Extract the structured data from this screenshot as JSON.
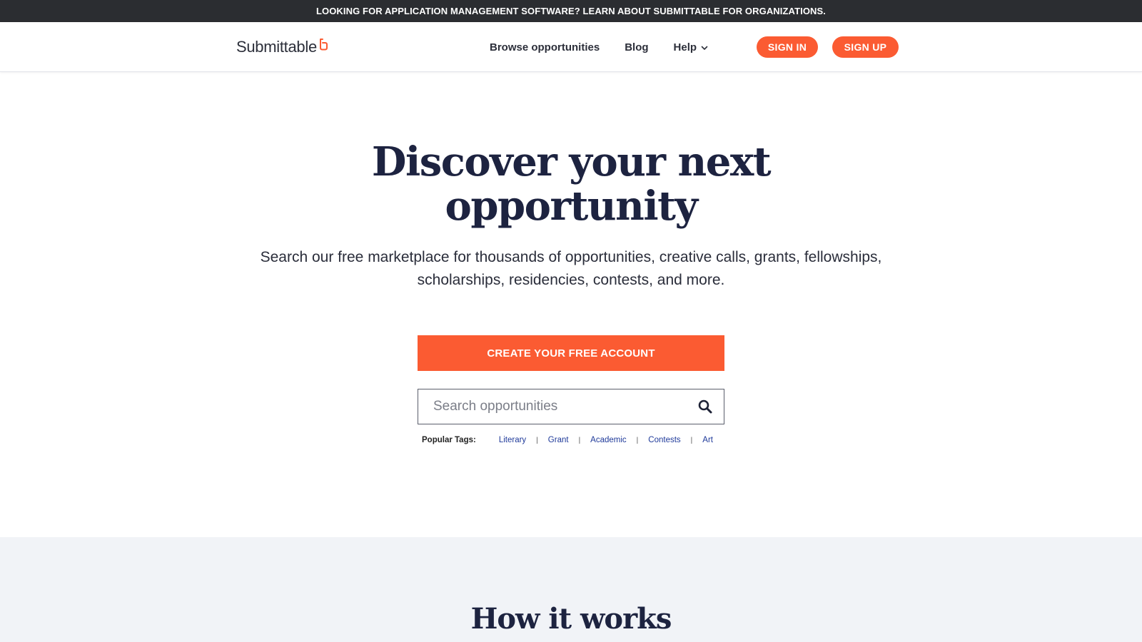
{
  "announcement": {
    "text": "LOOKING FOR APPLICATION MANAGEMENT SOFTWARE? LEARN ABOUT SUBMITTABLE FOR ORGANIZATIONS."
  },
  "header": {
    "logo_text": "Submittable",
    "logo_icon": "submittable-mark-icon",
    "nav": [
      {
        "label": "Browse opportunities"
      },
      {
        "label": "Blog"
      },
      {
        "label": "Help",
        "icon": "chevron-down-icon"
      }
    ],
    "sign_in_label": "SIGN IN",
    "sign_up_label": "SIGN UP"
  },
  "hero": {
    "title_line1": "Discover your next",
    "title_line2": "opportunity",
    "subtitle_line1": "Search our free marketplace for thousands of opportunities, creative calls, grants, fellowships,",
    "subtitle_line2": "scholarships, residencies, contests, and more.",
    "cta_label": "CREATE YOUR FREE ACCOUNT"
  },
  "search": {
    "placeholder": "Search opportunities",
    "value": "",
    "icon": "search-icon"
  },
  "popular_tags": {
    "label": "Popular Tags:",
    "tags": [
      "Literary",
      "Grant",
      "Academic",
      "Contests",
      "Art"
    ],
    "separator": "|"
  },
  "how_it_works": {
    "title": "How it works"
  },
  "colors": {
    "accent": "#fb5b32",
    "announcement_bg": "#2b2d31",
    "heading": "#1d2340",
    "tag_link": "#1f3a9a",
    "section_bg": "#f1f3f7"
  }
}
